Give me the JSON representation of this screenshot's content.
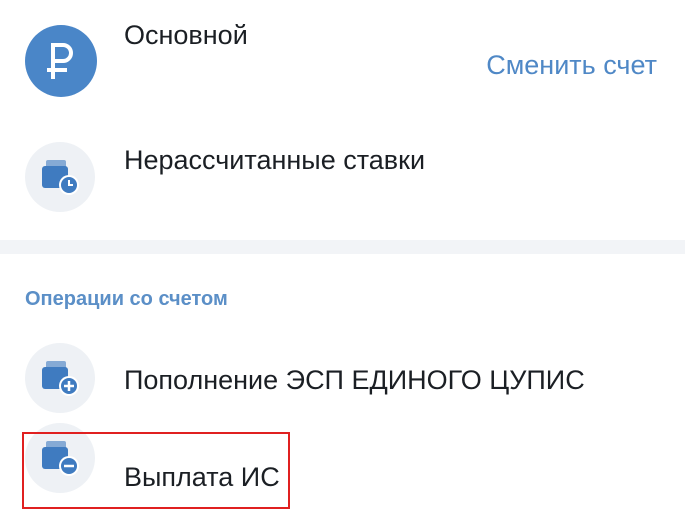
{
  "account": {
    "name": "Основной",
    "change_label": "Сменить счет",
    "icon": "ruble-icon"
  },
  "unsettled": {
    "label": "Нерассчитанные ставки",
    "icon": "wallet-clock-icon"
  },
  "operations": {
    "title": "Операции со счетом",
    "items": [
      {
        "label": "Пополнение ЭСП ЕДИНОГО ЦУПИС",
        "icon": "wallet-plus-icon"
      },
      {
        "label": "Выплата ИС",
        "icon": "wallet-minus-icon"
      }
    ]
  },
  "colors": {
    "accent": "#4a86c8",
    "link": "#4f88c6",
    "highlight": "#e02020",
    "icon_bg": "#eef1f5"
  }
}
